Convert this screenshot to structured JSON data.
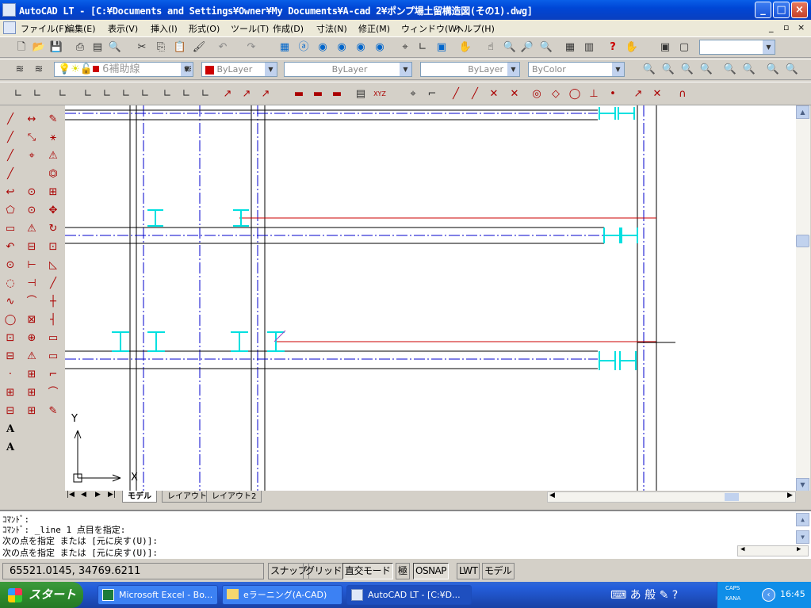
{
  "title": "AutoCAD LT - [C:¥Documents and Settings¥Owner¥My Documents¥A-cad 2¥ポンプ場土留構造図(その1).dwg]",
  "menu": [
    "ファイル(F)",
    "編集(E)",
    "表示(V)",
    "挿入(I)",
    "形式(O)",
    "ツール(T)",
    "作成(D)",
    "寸法(N)",
    "修正(M)",
    "ウィンドウ(W)",
    "ヘルプ(H)"
  ],
  "layer_combo": "6補助線",
  "color_combo": "ByLayer",
  "linetype_combo": "ByLayer",
  "lineweight_combo": "ByLayer",
  "plotstyle_combo": "ByColor",
  "tabs": [
    "モデル",
    "レイアウト1",
    "レイアウト2"
  ],
  "ucs": {
    "x_label": "X",
    "y_label": "Y"
  },
  "command_lines": [
    "ｺﾏﾝﾄﾞ:",
    "ｺﾏﾝﾄﾞ: _line 1 点目を指定:",
    "次の点を指定 または [元に戻す(U)]:",
    "次の点を指定 または [元に戻す(U)]:"
  ],
  "coords": "65521.0145, 34769.6211",
  "status_toggles": [
    {
      "label": "スナップ",
      "on": false
    },
    {
      "label": "グリッド",
      "on": false
    },
    {
      "label": "直交モード",
      "on": true
    },
    {
      "label": "極",
      "on": false
    },
    {
      "label": "OSNAP",
      "on": true
    },
    {
      "label": "LWT",
      "on": false
    },
    {
      "label": "モデル",
      "on": false
    }
  ],
  "taskbar": {
    "start": "スタート",
    "tasks": [
      "Microsoft Excel - Bo...",
      "eラーニング(A-CAD)",
      "AutoCAD LT - [C:¥D..."
    ],
    "time": "16:45",
    "ime": "あ 般",
    "caps": "CAPS",
    "kana": "KANA"
  },
  "colors": {
    "centerline": "#0000cc",
    "redline": "#cc0000",
    "hbeam": "#00e0e0",
    "titlebar": "#0046d5"
  }
}
